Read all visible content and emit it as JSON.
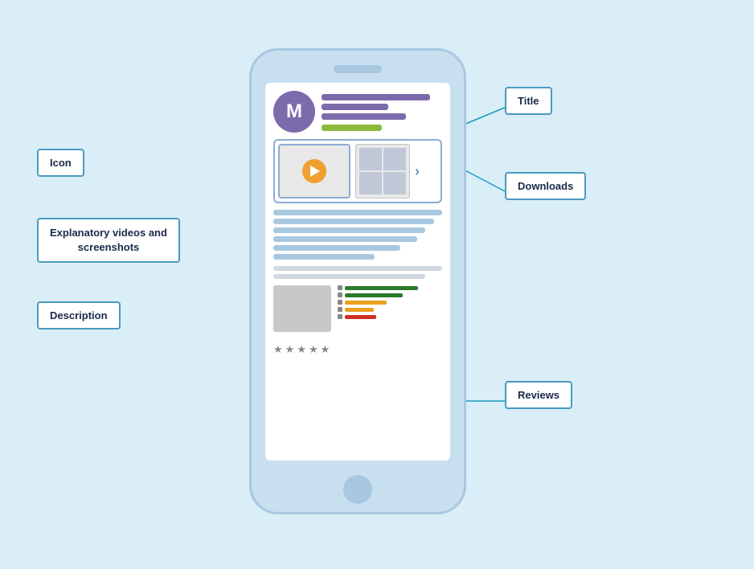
{
  "labels": {
    "title": "Title",
    "icon": "Icon",
    "explanatory": "Explanatory videos and\nscreenshots",
    "description": "Description",
    "downloads": "Downloads",
    "reviews": "Reviews"
  },
  "appIcon": "M",
  "stars": [
    "★",
    "★",
    "★",
    "★",
    "★"
  ],
  "ratingBars": [
    {
      "color": "#2a7a2a",
      "width": "70%"
    },
    {
      "color": "#2a7a2a",
      "width": "55%"
    },
    {
      "color": "#e8a020",
      "width": "40%"
    },
    {
      "color": "#e8a020",
      "width": "28%"
    },
    {
      "color": "#d03020",
      "width": "30%"
    }
  ]
}
